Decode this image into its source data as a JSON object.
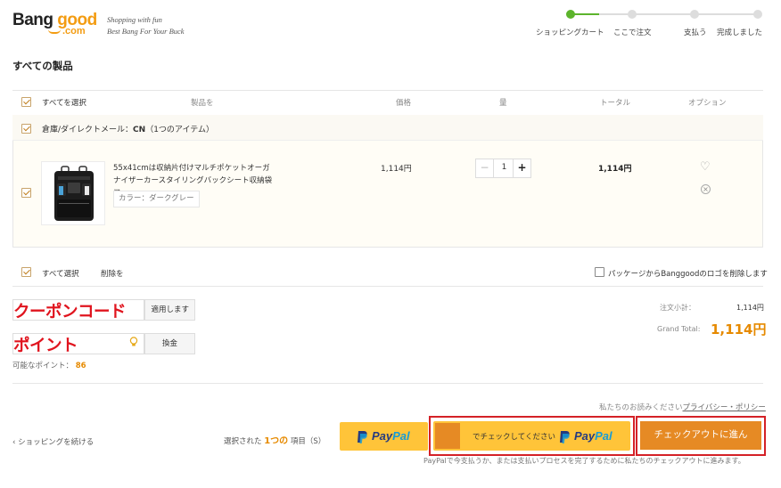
{
  "logo": {
    "brand": "Banggood",
    "brand_part1": "Bang",
    "brand_part2": "good",
    "domain": ".com",
    "tagline1": "Shopping with fun",
    "tagline2": "Best Bang For Your Buck"
  },
  "steps": [
    {
      "label": "ショッピングカート",
      "active": true
    },
    {
      "label": "ここで注文",
      "active": false
    },
    {
      "label": "支払う",
      "active": false
    },
    {
      "label": "完成しました",
      "active": false
    }
  ],
  "page_title": "すべての製品",
  "table_header": {
    "select_all": "すべてを選択",
    "product": "製品を",
    "price": "価格",
    "quantity": "量",
    "total": "トータル",
    "options": "オプション"
  },
  "warehouse": {
    "label": "倉庫/ダイレクトメール：",
    "code": "CN",
    "count": "（1つのアイテム）"
  },
  "item": {
    "name": "55x41cmは収納片付けマルチポケットオーガナイザーカースタイリングバックシート収納袋フ",
    "color": "カラー：ダークグレー",
    "price": "1,114円",
    "quantity": "1",
    "total": "1,114円"
  },
  "footer_row": {
    "select_all": "すべて選択",
    "delete": "削除を",
    "remove_logo": "パッケージからBanggoodのロゴを削除します"
  },
  "coupon": {
    "label": "クーポンコード",
    "apply": "適用します"
  },
  "point": {
    "label": "ポイント",
    "exchange": "換金",
    "available_label": "可能なポイント：",
    "available_value": "86"
  },
  "summary": {
    "subtotal_label": "注文小計：",
    "subtotal_value": "1,114円",
    "grand_total_label": "Grand Total:",
    "grand_total_value": "1,114円"
  },
  "privacy": {
    "prefix": "私たちのお読みください",
    "link": "プライバシー・ポリシー"
  },
  "bottom": {
    "continue": "ショッピングを続ける",
    "selected_prefix": "選択された",
    "selected_count": "1つの",
    "selected_suffix": "項目（S）",
    "paypal_word1": "Pay",
    "paypal_word2": "Pal",
    "paypal_checkout_text": "でチェックしてください",
    "checkout": "チェックアウトに進ん",
    "note": "PayPalで今支払うか、または支払いプロセスを完了するために私たちのチェックアウトに進みます。"
  },
  "colors": {
    "accent": "#e68a00",
    "progress": "#5cb42c",
    "paypal_yellow": "#ffc439",
    "annotation_red": "#e0141e"
  }
}
